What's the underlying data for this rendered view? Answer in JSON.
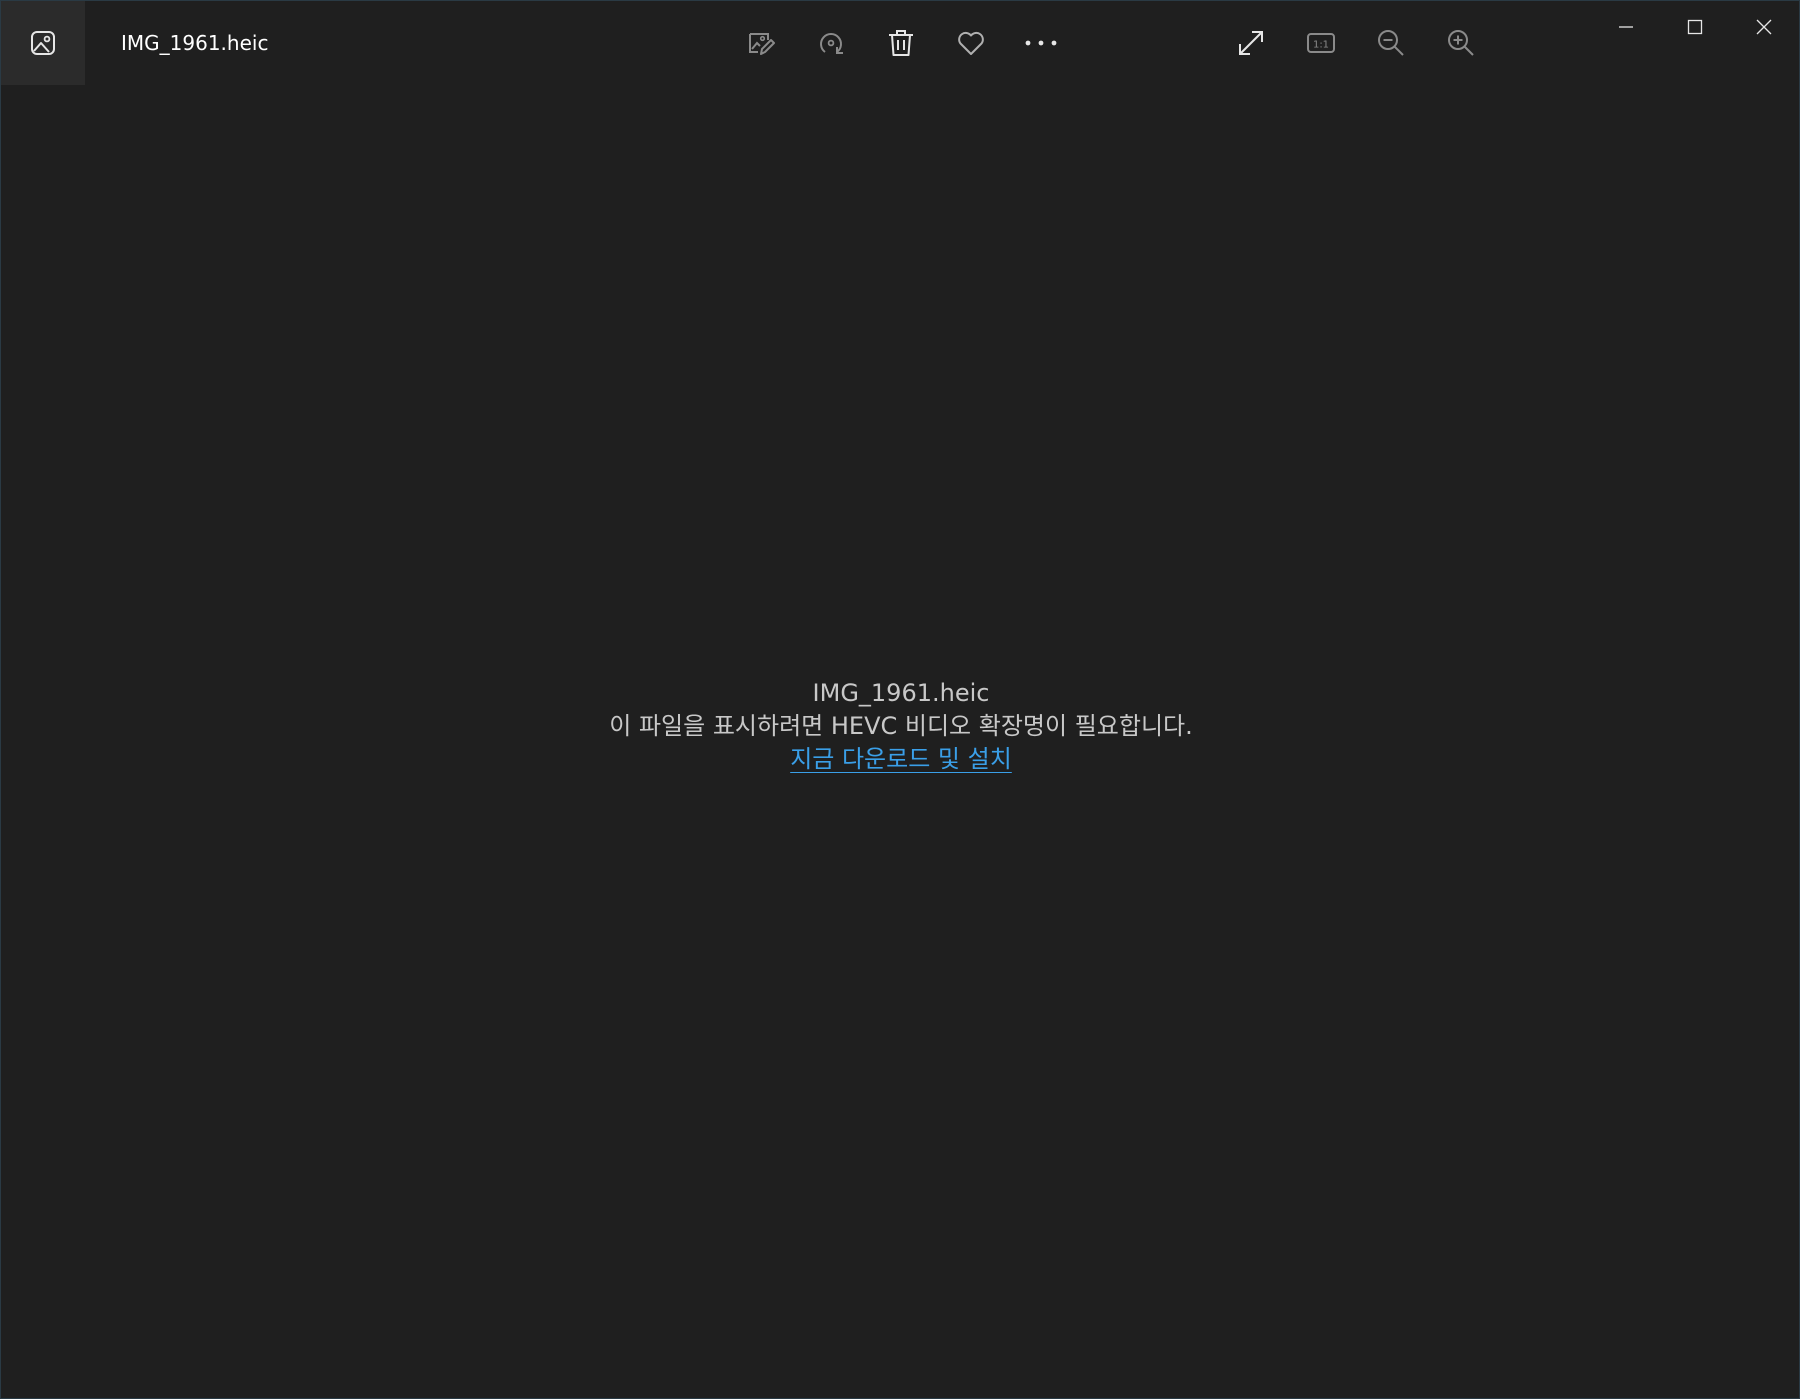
{
  "window": {
    "title": "IMG_1961.heic"
  },
  "toolbar": {
    "items": [
      {
        "name": "edit-image-icon"
      },
      {
        "name": "rotate-icon"
      },
      {
        "name": "delete-icon"
      },
      {
        "name": "favorite-heart-icon"
      },
      {
        "name": "more-options-icon"
      }
    ],
    "view_items": [
      {
        "name": "fullscreen-icon"
      },
      {
        "name": "actual-size-icon",
        "label": "1:1"
      },
      {
        "name": "zoom-out-icon"
      },
      {
        "name": "zoom-in-icon"
      }
    ]
  },
  "window_controls": [
    {
      "name": "minimize-icon"
    },
    {
      "name": "maximize-icon"
    },
    {
      "name": "close-icon"
    }
  ],
  "message": {
    "file_name": "IMG_1961.heic",
    "requirement": "이 파일을 표시하려면 HEVC 비디오 확장명이 필요합니다.",
    "link_label": "지금 다운로드 및 설치"
  },
  "colors": {
    "background": "#1f1f1f",
    "link": "#3a9fe8",
    "text": "#c8c8c8"
  }
}
